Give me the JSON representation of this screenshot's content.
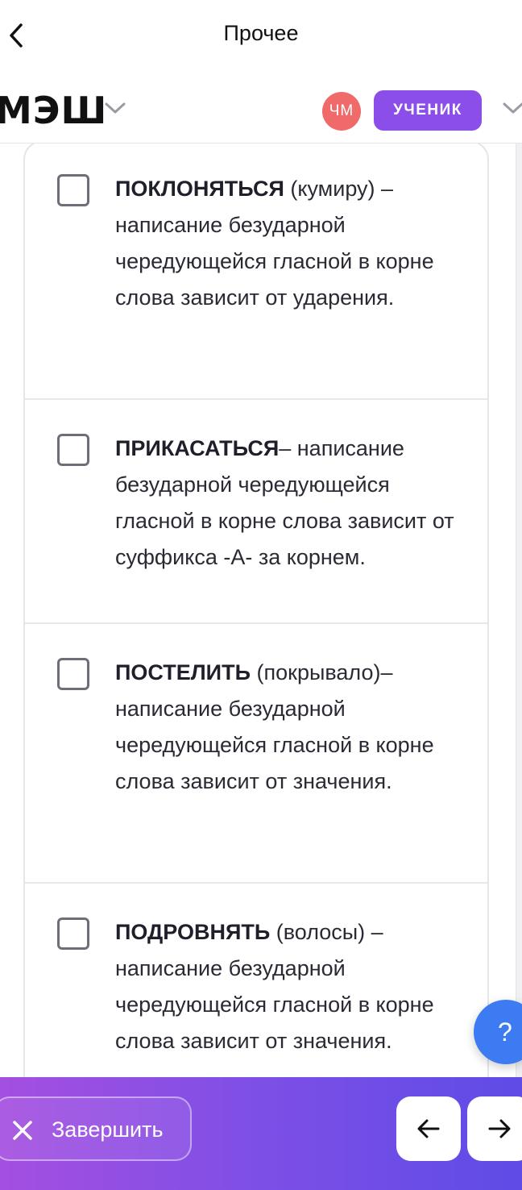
{
  "topbar": {
    "title": "Прочее",
    "back_icon": "chevron-left-icon"
  },
  "header": {
    "logo": "МЭШ",
    "avatar_initials": "ЧМ",
    "role": "УЧЕНИК",
    "avatar_color": "#f06a6a",
    "role_color": "#8b4ee8"
  },
  "options": [
    {
      "word": "ПОКЛОНЯТЬСЯ",
      "rest": " (кумиру) – написание безударной чередующейся гласной в корне слова зависит от ударения.",
      "checked": false
    },
    {
      "word": "ПРИКАСАТЬСЯ",
      "rest": "– написание безударной чередующейся гласной в корне слова зависит от суффикса -А- за корнем.",
      "checked": false
    },
    {
      "word": "ПОСТЕЛИТЬ",
      "rest": " (покрывало)– написание безударной чередующейся гласной в корне слова зависит от значения.",
      "checked": false
    },
    {
      "word": "ПОДРОВНЯТЬ",
      "rest": " (волосы) – написание безударной чередующейся гласной в корне слова зависит от значения.",
      "checked": false
    }
  ],
  "help": {
    "label": "?"
  },
  "bottom": {
    "finish_label": "Завершить",
    "prev_icon": "arrow-left-icon",
    "next_icon": "arrow-right-icon",
    "gradient_start": "#a44fe0",
    "gradient_end": "#5f4be6"
  }
}
